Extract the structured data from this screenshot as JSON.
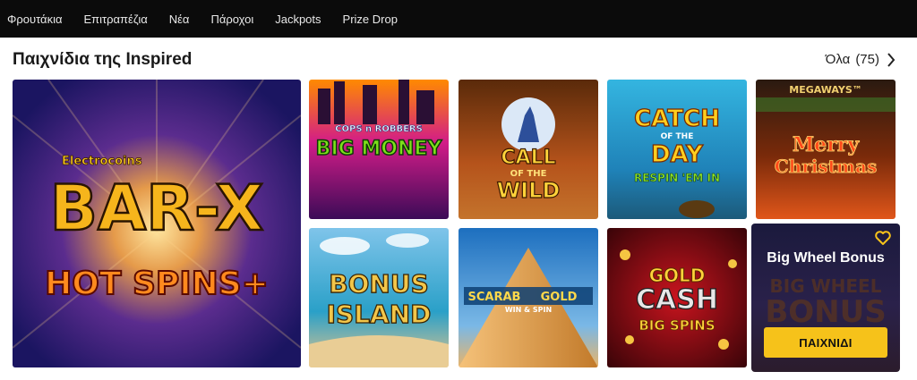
{
  "nav": {
    "items": [
      "Φρουτάκια",
      "Επιτραπέζια",
      "Νέα",
      "Πάροχοι",
      "Jackpots",
      "Prize Drop"
    ]
  },
  "section": {
    "title": "Παιχνίδια της Inspired",
    "view_all_label": "Όλα",
    "view_all_count": "(75)"
  },
  "games": {
    "featured": {
      "name": "Bar-X Hot Spins+",
      "art_lines": [
        "Electrocoins",
        "BAR-X",
        "HOT SPINS+"
      ]
    },
    "big_money": {
      "name": "Cops n Robbers Big Money",
      "art_lines": [
        "COPS n ROBBERS",
        "BIG MONEY"
      ]
    },
    "call_wild": {
      "name": "Call of the Wild",
      "art_lines": [
        "CALL",
        "OF THE",
        "WILD"
      ]
    },
    "catch_day": {
      "name": "Catch of the Day",
      "art_lines": [
        "CATCH",
        "OF THE",
        "DAY",
        "RESPIN 'EM IN"
      ]
    },
    "merry_xmas": {
      "name": "Merry Christmas Megaways",
      "art_lines": [
        "MEGAWAYS™",
        "Merry",
        "Christmas"
      ]
    },
    "bonus_island": {
      "name": "Bonus Island",
      "art_lines": [
        "BONUS",
        "ISLAND"
      ]
    },
    "scarab_gold": {
      "name": "Scarab Gold Win & Spin",
      "art_lines": [
        "SCARAB",
        "GOLD",
        "WIN & SPIN"
      ]
    },
    "gold_cash": {
      "name": "Gold Cash Big Spins",
      "art_lines": [
        "GOLD",
        "CASH",
        "BIG SPINS"
      ]
    },
    "big_wheel": {
      "name": "Big Wheel Bonus",
      "play_label": "ΠΑΙΧΝΙΔΙ",
      "art_lines": [
        "BIG WHEEL",
        "BONUS"
      ]
    }
  },
  "colors": {
    "accent": "#f6c21a",
    "nav_bg": "#0b0b0b"
  }
}
